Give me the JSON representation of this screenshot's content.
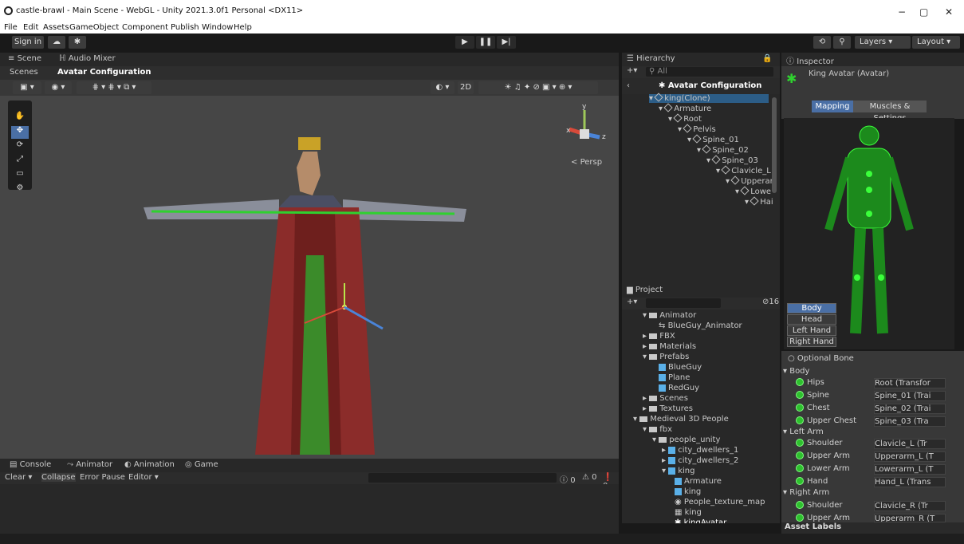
{
  "window": {
    "title": "castle-brawl - Main Scene - WebGL - Unity 2021.3.0f1 Personal <DX11>",
    "minimize": "−",
    "maximize": "▢",
    "close": "✕"
  },
  "menu": [
    "File",
    "Edit",
    "Assets",
    "GameObject",
    "Component",
    "Publish",
    "Window",
    "Help"
  ],
  "toolbar": {
    "signin": "Sign in",
    "layers": "Layers",
    "layout": "Layout"
  },
  "scene": {
    "tab_scene": "Scene",
    "tab_audio": "Audio Mixer",
    "crumb_scenes": "Scenes",
    "crumb_avatar": "Avatar Configuration",
    "persp": "Persp",
    "btn_2d": "2D"
  },
  "hierarchy": {
    "tab": "Hierarchy",
    "search": "All",
    "title": "Avatar Configuration",
    "items": [
      "king(Clone)",
      "Armature",
      "Root",
      "Pelvis",
      "Spine_01",
      "Spine_02",
      "Spine_03",
      "Clavicle_L",
      "Upperar",
      "Lowe",
      "Hai"
    ]
  },
  "project": {
    "tab": "Project",
    "count": "16",
    "items": [
      "Animator",
      "BlueGuy_Animator",
      "FBX",
      "Materials",
      "Prefabs",
      "BlueGuy",
      "Plane",
      "RedGuy",
      "Scenes",
      "Textures",
      "Medieval 3D People",
      "fbx",
      "people_unity",
      "city_dwellers_1",
      "city_dwellers_2",
      "king",
      "Armature",
      "king",
      "People_texture_map",
      "king",
      "kingAvatar"
    ]
  },
  "console": {
    "tabs": [
      "Console",
      "Animator",
      "Animation",
      "Game"
    ],
    "buttons": [
      "Clear",
      "Collapse",
      "Error Pause",
      "Editor"
    ],
    "counts": [
      "0",
      "0",
      "0"
    ]
  },
  "inspector": {
    "tab": "Inspector",
    "title": "King Avatar (Avatar)",
    "tab_mapping": "Mapping",
    "tab_muscles": "Muscles & Settings",
    "body_buttons": [
      "Body",
      "Head",
      "Left Hand",
      "Right Hand"
    ],
    "optional": "Optional Bone",
    "sections": {
      "body": "Body",
      "left_arm": "Left Arm",
      "right_arm": "Right Arm"
    },
    "bones": [
      {
        "name": "Hips",
        "value": "Root (Transfor"
      },
      {
        "name": "Spine",
        "value": "Spine_01 (Trai"
      },
      {
        "name": "Chest",
        "value": "Spine_02 (Trai"
      },
      {
        "name": "Upper Chest",
        "value": "Spine_03 (Tra"
      },
      {
        "name": "Shoulder",
        "value": "Clavicle_L (Tr"
      },
      {
        "name": "Upper Arm",
        "value": "Upperarm_L (T"
      },
      {
        "name": "Lower Arm",
        "value": "Lowerarm_L (T"
      },
      {
        "name": "Hand",
        "value": "Hand_L (Trans"
      },
      {
        "name": "Shoulder",
        "value": "Clavicle_R (Tr"
      },
      {
        "name": "Upper Arm",
        "value": "Upperarm_R (T"
      }
    ],
    "asset_labels": "Asset Labels"
  }
}
